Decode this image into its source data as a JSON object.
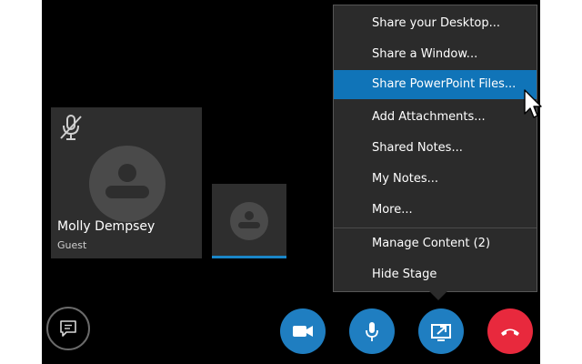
{
  "participant": {
    "name": "Molly Dempsey",
    "role": "Guest"
  },
  "share_menu": {
    "items": [
      {
        "label": "Share your Desktop..."
      },
      {
        "label": "Share a Window..."
      },
      {
        "label": "Share PowerPoint Files..."
      },
      {
        "label": "Add Attachments..."
      },
      {
        "label": "Shared Notes..."
      },
      {
        "label": "My Notes..."
      },
      {
        "label": "More..."
      },
      {
        "label": "Manage Content (2)"
      },
      {
        "label": "Hide Stage"
      }
    ],
    "highlighted_item": "Share PowerPoint Files..."
  },
  "icons": {
    "mute": "microphone-muted-icon",
    "chat": "chat-icon",
    "video": "video-camera-icon",
    "mic": "microphone-icon",
    "present": "present-content-icon",
    "hangup": "hang-up-icon"
  },
  "colors": {
    "stage_background": "#000000",
    "tile_background": "#2e2e2e",
    "control_blue": "#1f7ec1",
    "hangup_red": "#e8293d",
    "menu_highlight": "#1074b8"
  }
}
